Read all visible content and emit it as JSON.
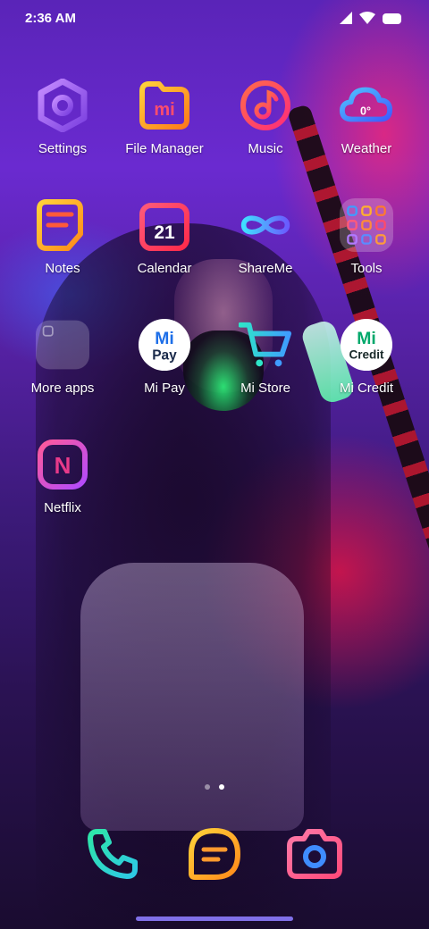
{
  "status_bar": {
    "time": "2:36 AM",
    "icons": [
      "signal-icon",
      "wifi-icon",
      "battery-icon"
    ]
  },
  "apps": [
    {
      "label": "Settings",
      "icon": "settings-icon"
    },
    {
      "label": "File Manager",
      "icon": "file-manager-icon"
    },
    {
      "label": "Music",
      "icon": "music-icon"
    },
    {
      "label": "Weather",
      "icon": "weather-icon",
      "badge": "0°"
    },
    {
      "label": "Notes",
      "icon": "notes-icon"
    },
    {
      "label": "Calendar",
      "icon": "calendar-icon",
      "badge": "21"
    },
    {
      "label": "ShareMe",
      "icon": "shareme-icon"
    },
    {
      "label": "Tools",
      "icon": "tools-folder-icon"
    },
    {
      "label": "More apps",
      "icon": "more-apps-folder-icon"
    },
    {
      "label": "Mi Pay",
      "icon": "mi-pay-icon",
      "line1": "Mi",
      "line2": "Pay"
    },
    {
      "label": "Mi Store",
      "icon": "mi-store-icon"
    },
    {
      "label": "Mi Credit",
      "icon": "mi-credit-icon",
      "line1": "Mi",
      "line2": "Credit"
    },
    {
      "label": "Netflix",
      "icon": "netflix-icon",
      "badge": "N"
    }
  ],
  "file_manager_badge": "mi",
  "page_indicator": {
    "pages": 2,
    "current": 2
  },
  "dock": [
    {
      "icon": "phone-icon"
    },
    {
      "icon": "messages-icon"
    },
    {
      "icon": "camera-icon"
    }
  ],
  "colors": {
    "accent_purple": "#9b5cf0",
    "accent_orange": "#ff9a2e",
    "accent_pink": "#ff3d7f",
    "accent_blue": "#3f8cff",
    "accent_teal": "#2ee6c8",
    "mi_green": "#00a86b",
    "mi_blue": "#1e6fe8"
  }
}
